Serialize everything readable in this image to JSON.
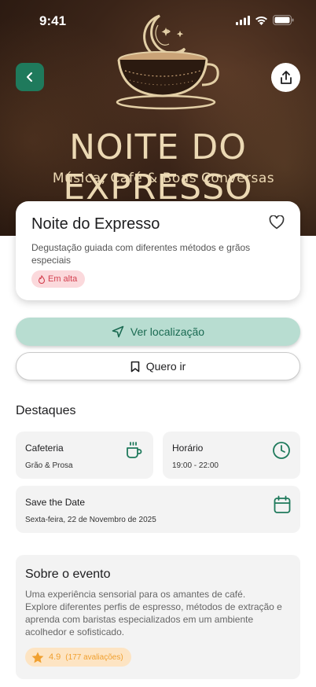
{
  "status_bar": {
    "time": "9:41"
  },
  "hero": {
    "title": "NOITE DO EXPRESSO",
    "subtitle": "Música, Café & Boas Conversas",
    "logo_icon": "coffee-cup-moon-icon"
  },
  "header": {
    "back_icon": "chevron-left-icon",
    "share_icon": "share-icon"
  },
  "event": {
    "title": "Noite do Expresso",
    "description": "Degustação guiada com diferentes métodos e grãos especiais",
    "badge": "Em alta",
    "favorite_icon": "heart-icon"
  },
  "actions": {
    "location_label": "Ver localização",
    "going_label": "Quero ir"
  },
  "highlights": {
    "title": "Destaques",
    "cafe": {
      "label": "Cafeteria",
      "value": "Grão & Prosa"
    },
    "time": {
      "label": "Horário",
      "value": "19:00 - 22:00"
    },
    "date": {
      "label": "Save the Date",
      "value": "Sexta-feira, 22 de Novembro de 2025"
    }
  },
  "about": {
    "title": "Sobre o evento",
    "text": "Uma experiência sensorial para os amantes de café.\n Explore diferentes perfis de espresso, métodos de extração e aprenda com baristas especializados em um ambiente acolhedor e sofisticado.",
    "rating": "4.9",
    "reviews": "(177 avaliações)"
  },
  "colors": {
    "primary": "#1f7a5c",
    "location_button": "#b8ddd1",
    "badge_bg": "#fbd9dc",
    "badge_text": "#d3404f",
    "rating_bg": "#fde4c3",
    "rating_text": "#f0a030",
    "card_bg": "#f3f3f3"
  }
}
